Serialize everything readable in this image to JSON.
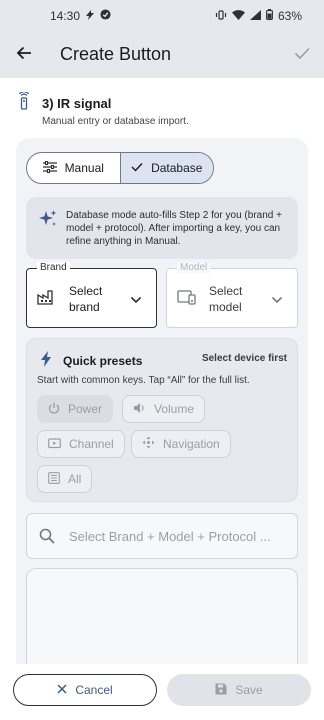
{
  "status_bar": {
    "time": "14:30",
    "battery": "63%",
    "left_icons": [
      "bolt-icon",
      "sync-icon"
    ],
    "right_icons": [
      "vibrate-icon",
      "wifi-icon",
      "signal-icon",
      "battery-icon"
    ]
  },
  "top_bar": {
    "title": "Create Button",
    "back_icon": "arrow-left-icon",
    "confirm_icon": "check-icon"
  },
  "section": {
    "title": "3) IR signal",
    "subtitle": "Manual entry or database import.",
    "icon": "remote-icon"
  },
  "mode_toggle": {
    "options": [
      {
        "label": "Manual",
        "icon": "sliders-icon",
        "selected": false
      },
      {
        "label": "Database",
        "icon": "check-icon",
        "selected": true
      }
    ]
  },
  "info": {
    "icon": "sparkle-icon",
    "text": "Database mode auto-fills Step 2 for you (brand + model + protocol). After importing a key, you can refine anything in Manual."
  },
  "brand_field": {
    "label": "Brand",
    "value": "Select brand",
    "icon": "factory-icon"
  },
  "model_field": {
    "label": "Model",
    "value": "Select model",
    "icon": "devices-icon"
  },
  "presets": {
    "title": "Quick presets",
    "status": "Select device first",
    "hint": "Start with common keys. Tap “All” for the full list.",
    "icon": "bolt-icon",
    "chips": [
      {
        "label": "Power",
        "icon": "power-icon"
      },
      {
        "label": "Volume",
        "icon": "volume-icon"
      },
      {
        "label": "Channel",
        "icon": "tv-icon"
      },
      {
        "label": "Navigation",
        "icon": "dpad-icon"
      },
      {
        "label": "All",
        "icon": "list-icon"
      }
    ]
  },
  "search": {
    "placeholder": "Select Brand + Model + Protocol ...",
    "icon": "search-icon"
  },
  "actions": {
    "cancel_label": "Cancel",
    "save_label": "Save",
    "accent": "#3d5a8c"
  }
}
